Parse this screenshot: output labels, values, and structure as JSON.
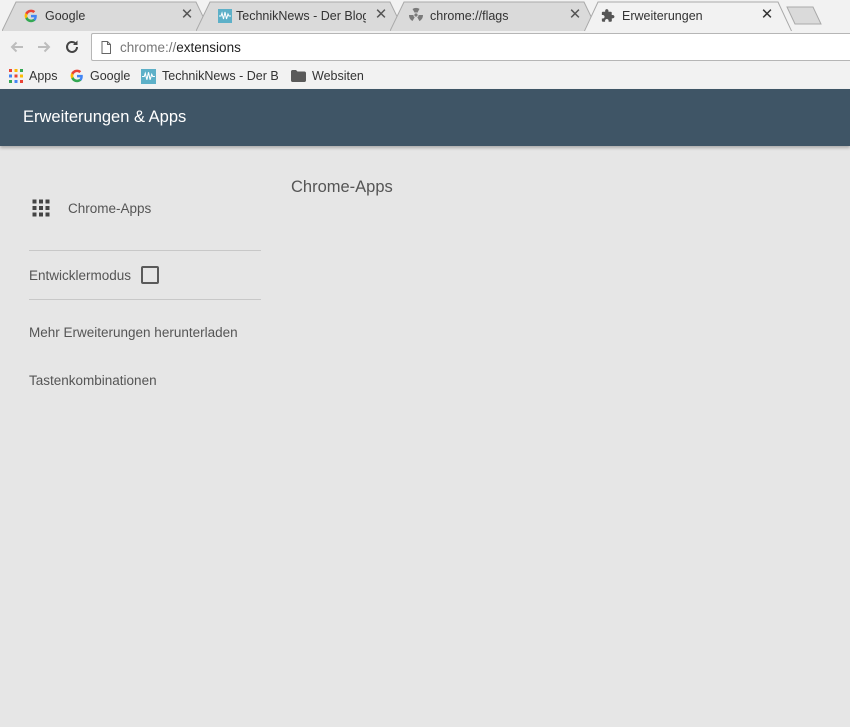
{
  "tabs": [
    {
      "title": "Google",
      "icon": "google-g-icon",
      "active": false
    },
    {
      "title": "TechnikNews - Der Blog f",
      "icon": "techniknews-icon",
      "active": false
    },
    {
      "title": "chrome://flags",
      "icon": "radiation-icon",
      "active": false
    },
    {
      "title": "Erweiterungen",
      "icon": "puzzle-icon",
      "active": true
    }
  ],
  "toolbar": {
    "url_scheme": "chrome://",
    "url_host": "extensions"
  },
  "bookmarks": [
    {
      "label": "Apps",
      "icon": "apps-grid-icon"
    },
    {
      "label": "Google",
      "icon": "google-g-icon"
    },
    {
      "label": "TechnikNews - Der Blo",
      "icon": "techniknews-icon"
    },
    {
      "label": "Websiten",
      "icon": "folder-icon"
    }
  ],
  "header": {
    "title": "Erweiterungen & Apps",
    "background": "#3f5566"
  },
  "sidebar": {
    "apps_label": "Chrome-Apps",
    "developer_mode_label": "Entwicklermodus",
    "developer_mode_checked": false,
    "more_extensions_label": "Mehr Erweiterungen herunterladen",
    "shortcuts_label": "Tastenkombinationen"
  },
  "main": {
    "section_title": "Chrome-Apps"
  }
}
